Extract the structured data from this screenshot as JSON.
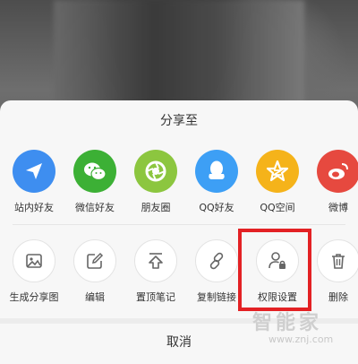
{
  "sheet": {
    "title": "分享至",
    "cancel_label": "取消"
  },
  "share_targets": [
    {
      "label": "站内好友",
      "icon": "paper-plane-icon",
      "color": "#3e8ef0"
    },
    {
      "label": "微信好友",
      "icon": "wechat-icon",
      "color": "#3cb035"
    },
    {
      "label": "朋友圈",
      "icon": "moments-icon",
      "color": "#8cc63f"
    },
    {
      "label": "QQ好友",
      "icon": "qq-penguin-icon",
      "color": "#3d9ff5"
    },
    {
      "label": "QQ空间",
      "icon": "qzone-star-icon",
      "color": "#f5b31a"
    },
    {
      "label": "微博",
      "icon": "weibo-icon",
      "color": "#e6493f"
    }
  ],
  "actions": [
    {
      "label": "生成分享图",
      "icon": "image-icon"
    },
    {
      "label": "编辑",
      "icon": "edit-icon"
    },
    {
      "label": "置顶笔记",
      "icon": "pin-top-icon"
    },
    {
      "label": "复制链接",
      "icon": "link-icon"
    },
    {
      "label": "权限设置",
      "icon": "user-lock-icon"
    },
    {
      "label": "删除",
      "icon": "trash-icon"
    }
  ],
  "annotation": {
    "highlight_color": "#e32124"
  },
  "watermark": {
    "text": "智能家",
    "url": "www.znj.com"
  }
}
